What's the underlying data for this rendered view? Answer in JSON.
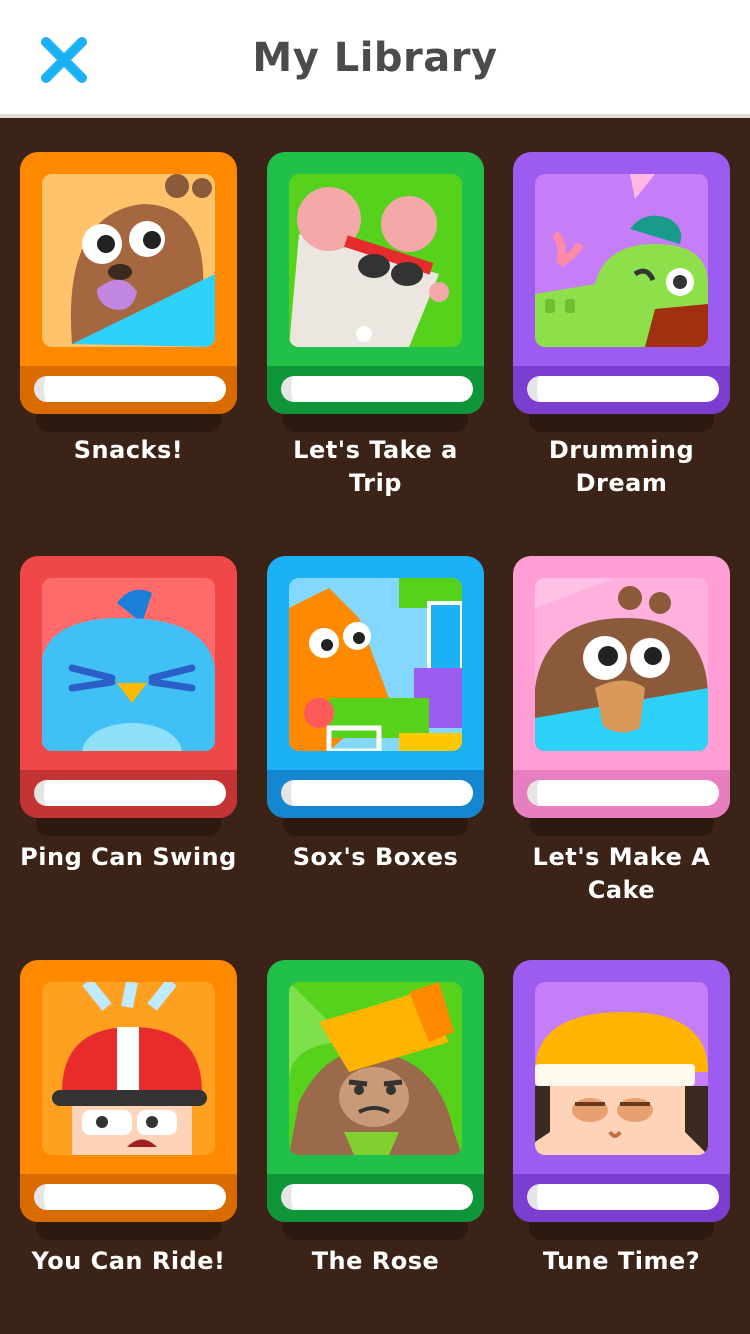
{
  "header": {
    "title": "My Library",
    "close_icon": "close-icon"
  },
  "colors": {
    "background": "#3c2317",
    "close_blue": "#1cb0f6",
    "title_gray": "#4b4b4b"
  },
  "books": [
    {
      "title": "Snacks!",
      "theme": "orange",
      "art": "bear-eating-icon"
    },
    {
      "title": "Let's Take a Trip",
      "theme": "green",
      "art": "mouse-sunglasses-icon"
    },
    {
      "title": "Drumming Dream",
      "theme": "purple",
      "art": "crocodile-winking-icon"
    },
    {
      "title": "Ping Can Swing",
      "theme": "red",
      "art": "blue-bird-icon"
    },
    {
      "title": "Sox's Boxes",
      "theme": "blue",
      "art": "fox-boxes-icon"
    },
    {
      "title": "Let's Make A Cake",
      "theme": "pink",
      "art": "bear-surprised-icon"
    },
    {
      "title": "You Can Ride!",
      "theme": "orange",
      "art": "helmet-rider-icon"
    },
    {
      "title": "The Rose",
      "theme": "green",
      "art": "monkey-hat-icon"
    },
    {
      "title": "Tune Time?",
      "theme": "purple",
      "art": "sleepy-kid-icon"
    }
  ]
}
